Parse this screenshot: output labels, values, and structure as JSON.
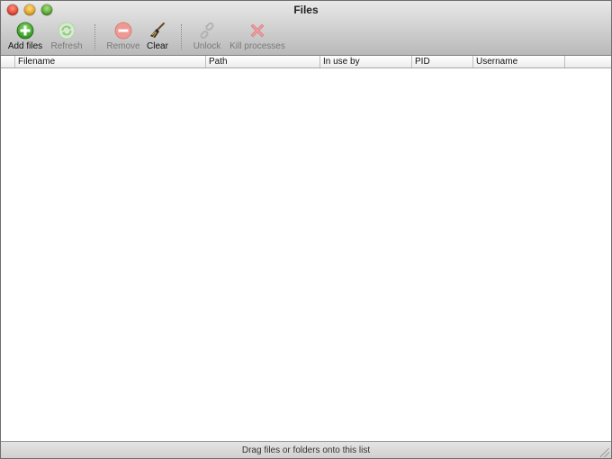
{
  "window": {
    "title": "Files"
  },
  "toolbar": {
    "add_files": "Add files",
    "refresh": "Refresh",
    "remove": "Remove",
    "clear": "Clear",
    "unlock": "Unlock",
    "kill_processes": "Kill processes"
  },
  "table": {
    "columns": [
      "Filename",
      "Path",
      "In use by",
      "PID",
      "Username"
    ],
    "rows": []
  },
  "footer": {
    "hint": "Drag files or folders onto this list"
  },
  "colors": {
    "add": "#3aa52a",
    "refresh": "#8fc77a",
    "remove": "#e8756f",
    "kill": "#e98a8a"
  }
}
